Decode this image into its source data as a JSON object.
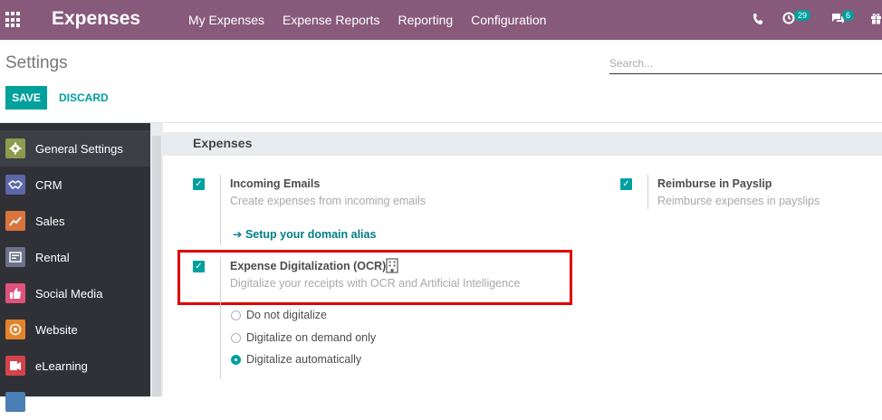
{
  "navbar": {
    "app_title": "Expenses",
    "menu": [
      "My Expenses",
      "Expense Reports",
      "Reporting",
      "Configuration"
    ],
    "systray": {
      "phone_icon": "phone-icon",
      "activity_count": "29",
      "messages_count": "6"
    }
  },
  "control_panel": {
    "title": "Settings",
    "search_placeholder": "Search...",
    "save_label": "SAVE",
    "discard_label": "DISCARD"
  },
  "sidebar": {
    "items": [
      {
        "label": "General Settings",
        "icon": "gear-icon",
        "color": "#8e9a4c"
      },
      {
        "label": "CRM",
        "icon": "handshake-icon",
        "color": "#5b67a8"
      },
      {
        "label": "Sales",
        "icon": "chart-icon",
        "color": "#d8743c"
      },
      {
        "label": "Rental",
        "icon": "rental-icon",
        "color": "#6b7289"
      },
      {
        "label": "Social Media",
        "icon": "thumbs-up-icon",
        "color": "#e0527e"
      },
      {
        "label": "Website",
        "icon": "globe-icon",
        "color": "#e3842b"
      },
      {
        "label": "eLearning",
        "icon": "elearning-icon",
        "color": "#d2444a"
      }
    ]
  },
  "section": {
    "title": "Expenses",
    "incoming_emails": {
      "title": "Incoming Emails",
      "description": "Create expenses from incoming emails",
      "link": "Setup your domain alias"
    },
    "reimburse_payslip": {
      "title": "Reimburse in Payslip",
      "description": "Reimburse expenses in payslips"
    },
    "ocr": {
      "title": "Expense Digitalization (OCR)",
      "description": "Digitalize your receipts with OCR and Artificial Intelligence",
      "options": [
        "Do not digitalize",
        "Digitalize on demand only",
        "Digitalize automatically"
      ],
      "selected": "Digitalize automatically"
    }
  }
}
